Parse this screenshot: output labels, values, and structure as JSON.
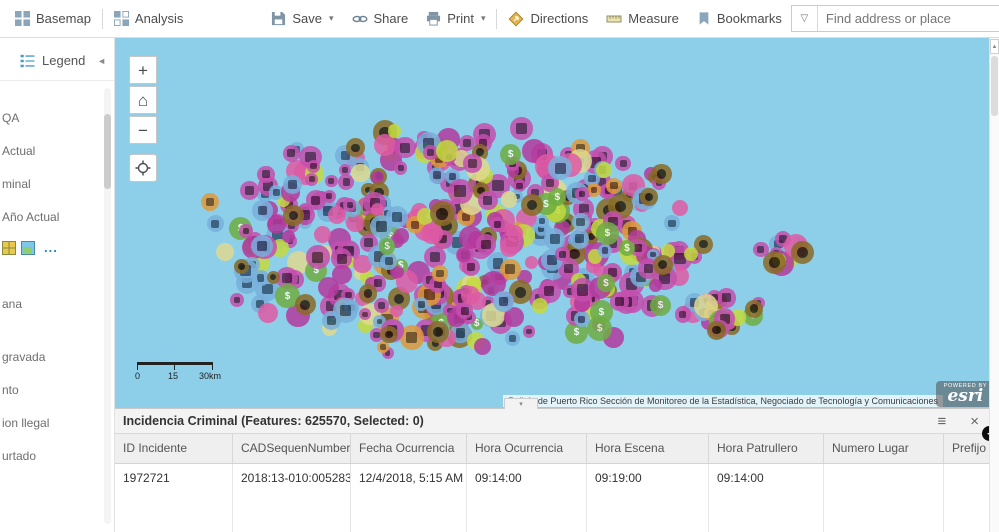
{
  "toolbar": {
    "basemap": "Basemap",
    "analysis": "Analysis",
    "save": "Save",
    "share": "Share",
    "print": "Print",
    "directions": "Directions",
    "measure": "Measure",
    "bookmarks": "Bookmarks",
    "search_placeholder": "Find address or place"
  },
  "icons": {
    "caret": "▾",
    "geocoder_caret": "▽",
    "menu": "≡",
    "close": "×",
    "collapse": "◄",
    "scroll_up": "▲",
    "plus": "+",
    "minus": "−",
    "home": "⌂",
    "more": "...",
    "tab_caret": "▾",
    "col_scroll": "◄"
  },
  "sidebar": {
    "title": "Legend",
    "items_top": [
      "QA",
      "Actual",
      "minal",
      "Año Actual"
    ],
    "items_bottom": [
      "ana",
      "gravada",
      "nto",
      "ion llegal",
      "urtado"
    ]
  },
  "map": {
    "water_color": "#8DCFE9",
    "scale": {
      "labels": [
        "0",
        "15",
        "30km"
      ]
    },
    "attribution": "Policía de Puerto Rico Sección de Monitoreo de la Estadística, Negociado de Tecnología y Comunicaciones",
    "powered_by": "POWERED BY",
    "esri": "esri",
    "marker_palette": [
      {
        "color": "#c44fae",
        "type": "glyph",
        "glyph_color": "#551c4b",
        "weight": 30
      },
      {
        "color": "#b33a9e",
        "type": "plain",
        "weight": 12
      },
      {
        "color": "#79b0dc",
        "type": "glyph",
        "glyph_color": "#2e4f6e",
        "weight": 16
      },
      {
        "color": "#8a6b26",
        "type": "ring",
        "weight": 12
      },
      {
        "color": "#c3d93d",
        "type": "plain",
        "weight": 8
      },
      {
        "color": "#ded98f",
        "type": "plain",
        "weight": 5
      },
      {
        "color": "#6fae43",
        "type": "dollar",
        "glyph": "$",
        "weight": 5
      },
      {
        "color": "#e09a39",
        "type": "glyph",
        "glyph_color": "#6e4410",
        "weight": 4
      },
      {
        "color": "#de5aa5",
        "type": "plain",
        "weight": 8
      }
    ]
  },
  "table": {
    "title": "Incidencia Criminal (Features: 625570, Selected: 0)",
    "columns": [
      "ID Incidente",
      "CADSequenNumber",
      "Fecha Ocurrencia",
      "Hora Ocurrencia",
      "Hora Escena",
      "Hora Patrullero",
      "Numero Lugar",
      "Prefijo"
    ],
    "rows": [
      [
        "1972721",
        "2018:13-010:005283",
        "12/4/2018, 5:15 AM",
        "09:14:00",
        "09:19:00",
        "09:14:00",
        "",
        ""
      ]
    ]
  }
}
